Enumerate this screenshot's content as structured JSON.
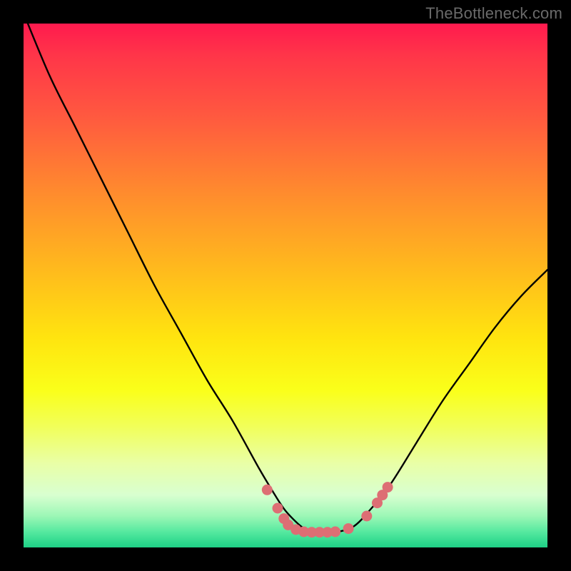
{
  "watermark": "TheBottleneck.com",
  "chart_data": {
    "type": "line",
    "title": "",
    "xlabel": "",
    "ylabel": "",
    "xlim": [
      0,
      100
    ],
    "ylim": [
      0,
      100
    ],
    "series": [
      {
        "name": "bottleneck-curve",
        "x": [
          0,
          5,
          10,
          15,
          20,
          25,
          30,
          35,
          40,
          45,
          48,
          50,
          53,
          55,
          58,
          60,
          63,
          66,
          70,
          75,
          80,
          85,
          90,
          95,
          100
        ],
        "values": [
          102,
          90,
          80,
          70,
          60,
          50,
          41,
          32,
          24,
          15,
          10,
          7,
          4,
          3,
          3,
          3,
          4,
          7,
          12,
          20,
          28,
          35,
          42,
          48,
          53
        ]
      }
    ],
    "markers": {
      "name": "highlight-dots",
      "color": "#dd6e74",
      "points": [
        {
          "x": 46.5,
          "y": 11.0
        },
        {
          "x": 48.5,
          "y": 7.5
        },
        {
          "x": 49.7,
          "y": 5.5
        },
        {
          "x": 50.5,
          "y": 4.3
        },
        {
          "x": 52.0,
          "y": 3.4
        },
        {
          "x": 53.5,
          "y": 3.0
        },
        {
          "x": 55.0,
          "y": 2.9
        },
        {
          "x": 56.5,
          "y": 2.9
        },
        {
          "x": 58.0,
          "y": 2.9
        },
        {
          "x": 59.5,
          "y": 3.0
        },
        {
          "x": 62.0,
          "y": 3.6
        },
        {
          "x": 65.5,
          "y": 6.0
        },
        {
          "x": 67.5,
          "y": 8.5
        },
        {
          "x": 68.5,
          "y": 10.0
        },
        {
          "x": 69.5,
          "y": 11.5
        }
      ]
    },
    "gradient_stops": [
      {
        "pos": 0,
        "color": "#ff1a4e"
      },
      {
        "pos": 6,
        "color": "#ff3549"
      },
      {
        "pos": 18,
        "color": "#ff5a3f"
      },
      {
        "pos": 32,
        "color": "#ff8a2e"
      },
      {
        "pos": 46,
        "color": "#ffb71e"
      },
      {
        "pos": 60,
        "color": "#ffe40f"
      },
      {
        "pos": 70,
        "color": "#faff1a"
      },
      {
        "pos": 77,
        "color": "#f1ff5a"
      },
      {
        "pos": 84,
        "color": "#e9ffa7"
      },
      {
        "pos": 90,
        "color": "#d8ffd0"
      },
      {
        "pos": 94,
        "color": "#9cf7b6"
      },
      {
        "pos": 97,
        "color": "#56e9a0"
      },
      {
        "pos": 99,
        "color": "#2fd98e"
      },
      {
        "pos": 100,
        "color": "#20d086"
      }
    ]
  }
}
